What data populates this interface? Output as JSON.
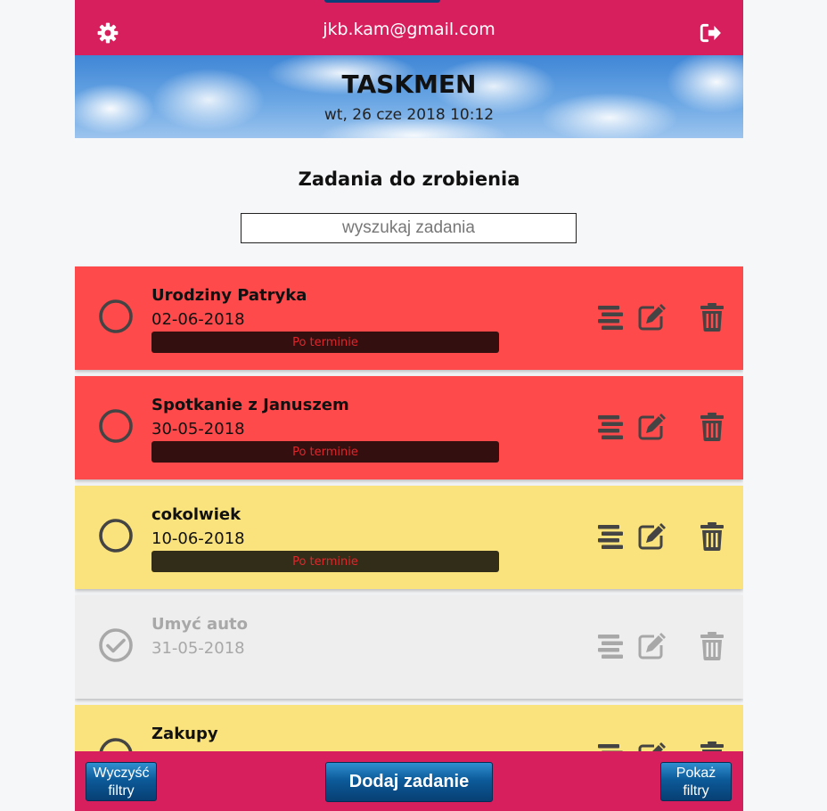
{
  "header": {
    "email": "jkb.kam@gmail.com",
    "settings_icon": "gear-icon",
    "logout_icon": "sign-out-icon",
    "background_color": "#d81f5e"
  },
  "hero": {
    "title": "TASKMEN",
    "datetime": "wt, 26 cze 2018 10:12"
  },
  "main": {
    "section_title": "Zadania do zrobienia",
    "search_placeholder": "wyszukaj zadania",
    "search_value": ""
  },
  "tasks": [
    {
      "name": "Urodziny Patryka",
      "date": "02-06-2018",
      "status": "Po terminie",
      "state": "overdue",
      "done": false,
      "color": "#ff4a4c"
    },
    {
      "name": "Spotkanie z Januszem",
      "date": "30-05-2018",
      "status": "Po terminie",
      "state": "overdue",
      "done": false,
      "color": "#ff4a4c"
    },
    {
      "name": "cokolwiek",
      "date": "10-06-2018",
      "status": "Po terminie",
      "state": "pending",
      "done": false,
      "color": "#fae27c"
    },
    {
      "name": "Umyć auto",
      "date": "31-05-2018",
      "status": "",
      "state": "done",
      "done": true,
      "color": "#eeeeee"
    },
    {
      "name": "Zakupy",
      "date": "",
      "status": "",
      "state": "pending",
      "done": false,
      "color": "#fae27c"
    }
  ],
  "task_icons": {
    "details": "list-icon",
    "edit": "edit-icon",
    "delete": "trash-icon"
  },
  "footer": {
    "clear_filters": "Wyczyść filtry",
    "add_task": "Dodaj zadanie",
    "show_filters": "Pokaż filtry"
  }
}
